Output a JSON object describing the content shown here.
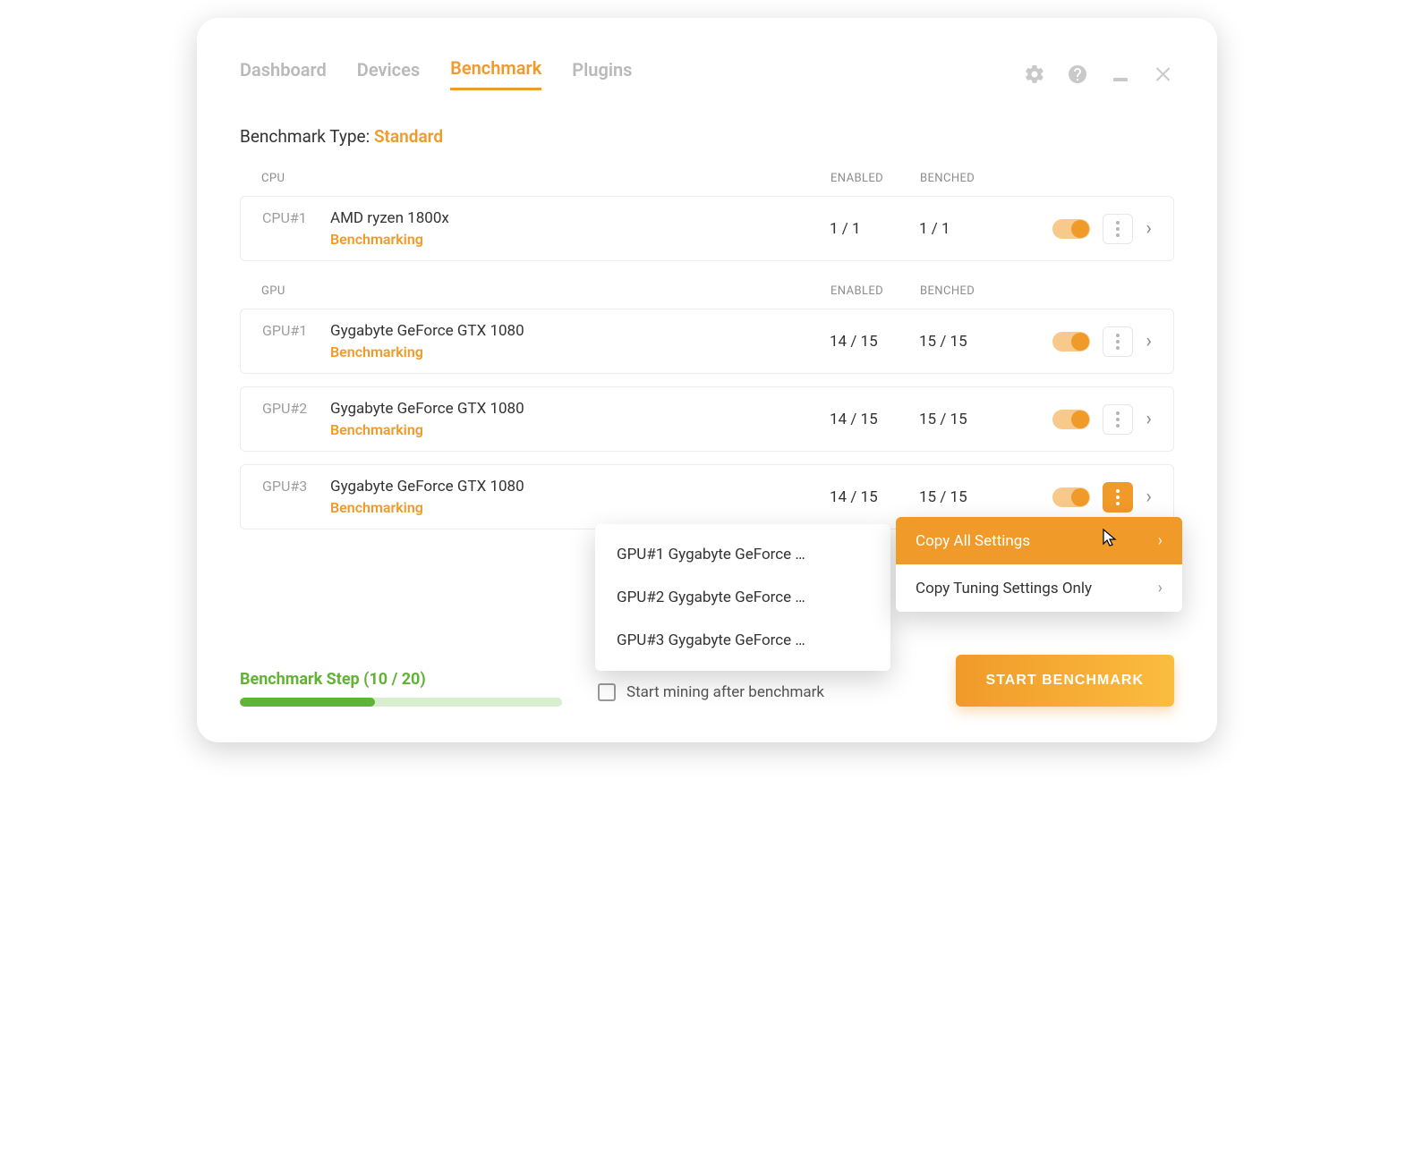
{
  "nav": {
    "tabs": [
      "Dashboard",
      "Devices",
      "Benchmark",
      "Plugins"
    ],
    "active_index": 2
  },
  "bench_type": {
    "label": "Benchmark Type: ",
    "value": "Standard"
  },
  "columns": {
    "enabled": "ENABLED",
    "benched": "BENCHED"
  },
  "sections": [
    {
      "title": "CPU",
      "rows": [
        {
          "id": "CPU#1",
          "name": "AMD ryzen 1800x",
          "status": "Benchmarking",
          "enabled": "1 / 1",
          "benched": "1 / 1",
          "toggle": true
        }
      ]
    },
    {
      "title": "GPU",
      "rows": [
        {
          "id": "GPU#1",
          "name": "Gygabyte GeForce GTX 1080",
          "status": "Benchmarking",
          "enabled": "14 / 15",
          "benched": "15 / 15",
          "toggle": true
        },
        {
          "id": "GPU#2",
          "name": "Gygabyte GeForce GTX 1080",
          "status": "Benchmarking",
          "enabled": "14 / 15",
          "benched": "15 / 15",
          "toggle": true
        },
        {
          "id": "GPU#3",
          "name": "Gygabyte GeForce GTX 1080",
          "status": "Benchmarking",
          "enabled": "14 / 15",
          "benched": "15 / 15",
          "toggle": true
        }
      ]
    }
  ],
  "context_menu": {
    "copy_all": "Copy All Settings",
    "copy_tuning": "Copy Tuning Settings Only"
  },
  "sub_menu": [
    "GPU#1 Gygabyte GeForce …",
    "GPU#2 Gygabyte GeForce …",
    "GPU#3 Gygabyte GeForce …"
  ],
  "footer": {
    "progress_label": "Benchmark Step (10 / 20)",
    "progress_pct": 42,
    "checkbox_label": "Start mining after benchmark",
    "start_button": "START BENCHMARK"
  }
}
